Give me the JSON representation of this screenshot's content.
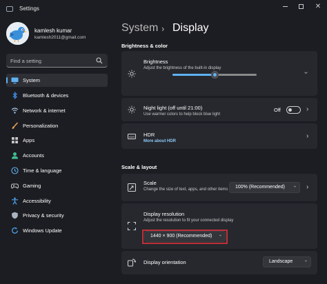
{
  "window": {
    "title": "Settings"
  },
  "user": {
    "name": "kamlesh kumar",
    "email": "kamlesh2011@gmail.com"
  },
  "search": {
    "placeholder": "Find a setting"
  },
  "sidebar": {
    "items": [
      {
        "label": "System",
        "icon": "monitor-icon",
        "color": "#5fb2f2",
        "active": true
      },
      {
        "label": "Bluetooth & devices",
        "icon": "bluetooth-icon",
        "color": "#3d8ee6"
      },
      {
        "label": "Network & internet",
        "icon": "wifi-icon",
        "color": "#a8c7e8"
      },
      {
        "label": "Personalization",
        "icon": "brush-icon",
        "color": "#e9a05a"
      },
      {
        "label": "Apps",
        "icon": "apps-icon",
        "color": "#c9c9c9"
      },
      {
        "label": "Accounts",
        "icon": "person-icon",
        "color": "#3fbf8f"
      },
      {
        "label": "Time & language",
        "icon": "globe-clock-icon",
        "color": "#5fb2f2"
      },
      {
        "label": "Gaming",
        "icon": "gamepad-icon",
        "color": "#c9c9c9"
      },
      {
        "label": "Accessibility",
        "icon": "accessibility-icon",
        "color": "#4aa3f0"
      },
      {
        "label": "Privacy & security",
        "icon": "shield-icon",
        "color": "#a9b4c2"
      },
      {
        "label": "Windows Update",
        "icon": "update-icon",
        "color": "#4aa3f0"
      }
    ]
  },
  "header": {
    "system": "System",
    "separator": "›",
    "display": "Display"
  },
  "sections": {
    "brightness_color": "Brightness & color",
    "scale_layout": "Scale & layout"
  },
  "brightness": {
    "title": "Brightness",
    "desc": "Adjust the brightness of the built-in display",
    "level": 0.5
  },
  "night_light": {
    "title": "Night light (off until 21:00)",
    "desc": "Use warmer colors to help block blue light",
    "state": "Off"
  },
  "hdr": {
    "title": "HDR",
    "link": "More about HDR"
  },
  "scale": {
    "title": "Scale",
    "desc": "Change the size of text, apps, and other items",
    "value": "100% (Recommended)"
  },
  "resolution": {
    "title": "Display resolution",
    "desc": "Adjust the resolution to fit your connected display",
    "value": "1440 × 900 (Recommended)"
  },
  "orientation": {
    "title": "Display orientation",
    "value": "Landscape"
  },
  "colors": {
    "accent": "#5fb2f2",
    "highlight": "#c0303a",
    "card": "#26282e",
    "background": "#1c1d22"
  }
}
